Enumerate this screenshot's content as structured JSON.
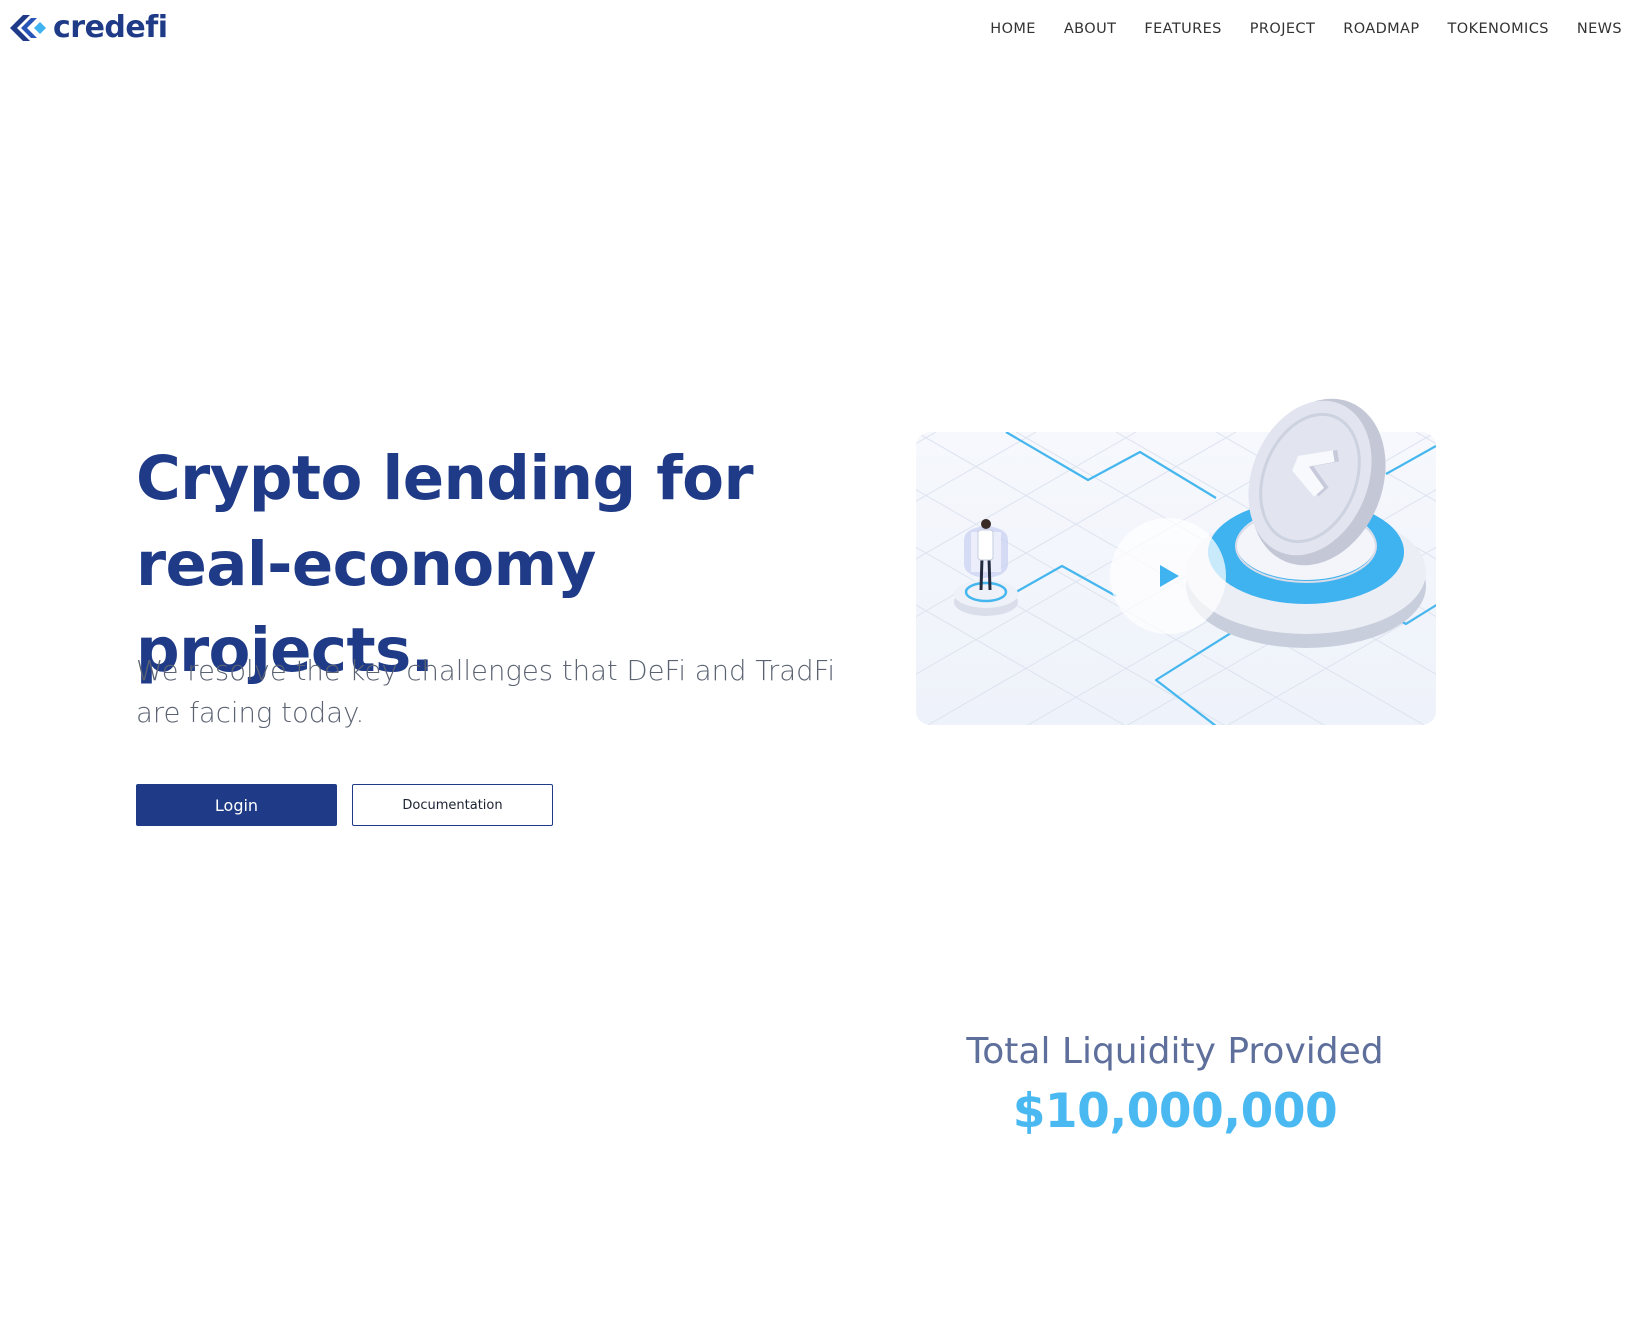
{
  "brand": {
    "name": "credefi",
    "color": "#1f3b87"
  },
  "nav": {
    "items": [
      {
        "label": "HOME"
      },
      {
        "label": "ABOUT"
      },
      {
        "label": "FEATURES"
      },
      {
        "label": "PROJECT"
      },
      {
        "label": "ROADMAP"
      },
      {
        "label": "TOKENOMICS"
      },
      {
        "label": "NEWS"
      }
    ]
  },
  "hero": {
    "title_line_1": "Crypto lending for",
    "title_line_2": "real-economy projects.",
    "subtitle": "We resolve the key challenges that DeFi and TradFi are facing today.",
    "login_label": "Login",
    "docs_label": "Documentation"
  },
  "illustration": {
    "icon": "play-icon",
    "accent": "#3fb2f0"
  },
  "stats": {
    "label": "Total Liquidity Provided",
    "value": "$10,000,000",
    "value_color": "#4ab9f2"
  }
}
